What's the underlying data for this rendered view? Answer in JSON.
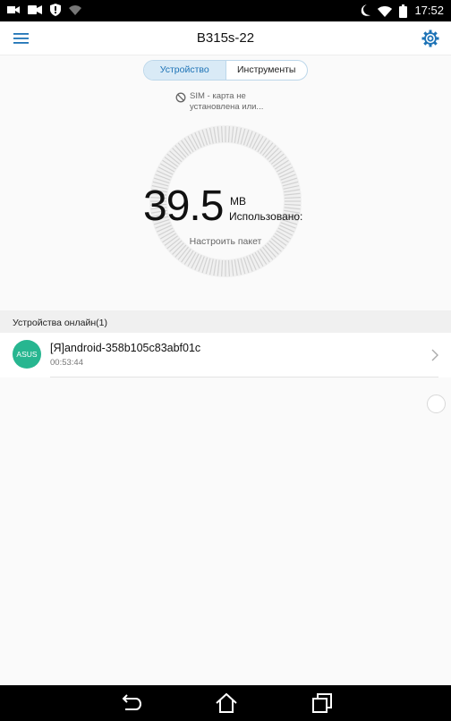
{
  "status_bar": {
    "time": "17:52",
    "icons": [
      "video-icon",
      "camcorder-icon",
      "shield-icon",
      "wifi-off-icon",
      "moon-icon",
      "wifi-icon",
      "battery-icon"
    ]
  },
  "app_bar": {
    "title": "B315s-22",
    "menu_icon": "menu-icon",
    "settings_icon": "gear-icon"
  },
  "tabs": [
    {
      "label": "Устройство",
      "active": true
    },
    {
      "label": "Инструменты",
      "active": false
    }
  ],
  "sim_status": {
    "line1": "SIM - карта не",
    "line2": "установлена или..."
  },
  "usage": {
    "value": "39.5",
    "unit": "MB",
    "label": "Использовано:",
    "configure_link": "Настроить пакет"
  },
  "devices_section": {
    "title": "Устройства онлайн(1)",
    "devices": [
      {
        "avatar": "ASUS",
        "name": "[Я]android-358b105c83abf01c",
        "time": "00:53:44"
      }
    ]
  },
  "colors": {
    "accent": "#1d73b6",
    "avatar": "#27b690",
    "tab_active_bg": "#d9eaf6"
  },
  "nav_bar": [
    "back-icon",
    "home-icon",
    "recents-icon"
  ]
}
